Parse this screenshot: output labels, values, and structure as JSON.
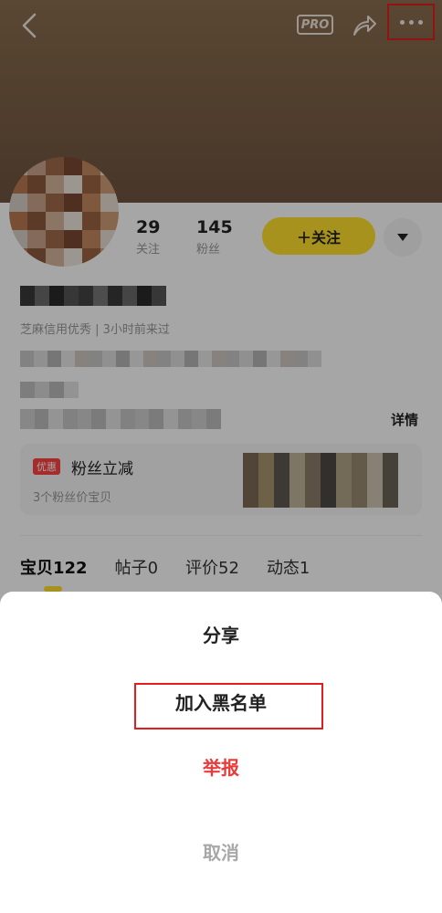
{
  "header": {
    "pro_label": "PRO"
  },
  "profile": {
    "following_count": "29",
    "following_label": "关注",
    "followers_count": "145",
    "followers_label": "粉丝",
    "follow_button_label": "＋关注",
    "credit_text": "芝麻信用优秀 | 3小时前来过",
    "detail_label": "详情"
  },
  "promo": {
    "badge": "优惠",
    "title": "粉丝立减",
    "subtitle": "3个粉丝价宝贝"
  },
  "tabs": [
    {
      "label": "宝贝122"
    },
    {
      "label": "帖子0"
    },
    {
      "label": "评价52"
    },
    {
      "label": "动态1"
    }
  ],
  "action_sheet": {
    "share": "分享",
    "blacklist": "加入黑名单",
    "report": "举报",
    "cancel": "取消"
  },
  "colors": {
    "accent_yellow": "#ffe02b",
    "report_red": "#ea3b3b",
    "highlight_red": "#e21d1d"
  }
}
